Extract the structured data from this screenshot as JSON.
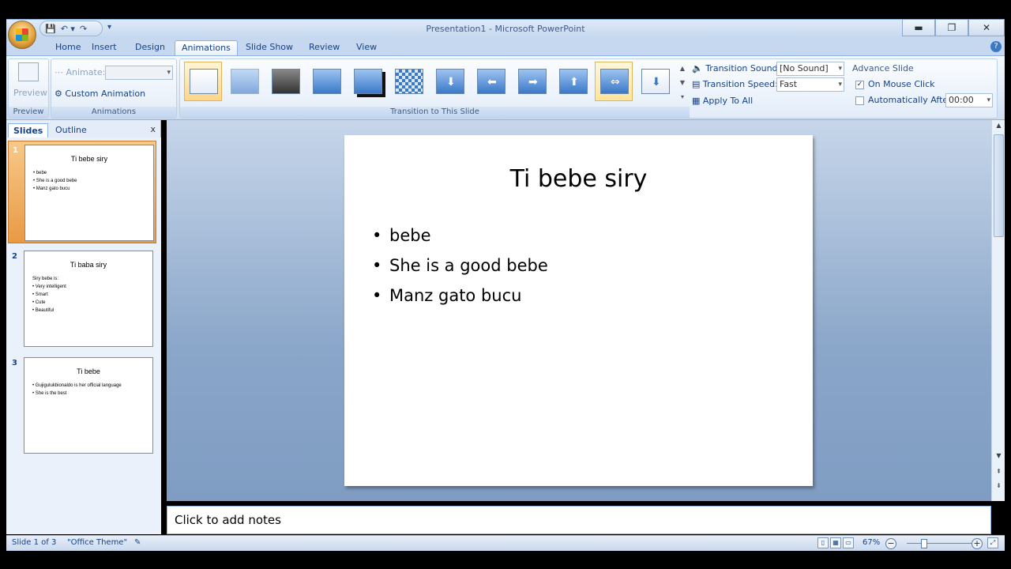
{
  "window": {
    "title": "Presentation1 - Microsoft PowerPoint",
    "minimize": "▬",
    "restore": "❐",
    "close": "✕"
  },
  "qat": {
    "save": "💾",
    "undo": "↶ ▾",
    "redo": "↷",
    "more": "▾"
  },
  "tabs": [
    {
      "label": "Home"
    },
    {
      "label": "Insert"
    },
    {
      "label": "Design"
    },
    {
      "label": "Animations"
    },
    {
      "label": "Slide Show"
    },
    {
      "label": "Review"
    },
    {
      "label": "View"
    }
  ],
  "active_tab": "Animations",
  "ribbon": {
    "preview": {
      "button": "Preview",
      "group": "Preview"
    },
    "animations": {
      "animate_label": "Animate:",
      "custom_animation": "Custom Animation",
      "group": "Animations"
    },
    "transition_group": "Transition to This Slide",
    "transition_sound_label": "Transition Sound:",
    "transition_sound_value": "[No Sound]",
    "transition_speed_label": "Transition Speed:",
    "transition_speed_value": "Fast",
    "apply_to_all": "Apply To All",
    "advance_slide": "Advance Slide",
    "on_mouse_click": "On Mouse Click",
    "on_mouse_click_checked": "✓",
    "automatically_after": "Automatically After:",
    "automatically_after_value": "00:00"
  },
  "slides_panel": {
    "tab_slides": "Slides",
    "tab_outline": "Outline",
    "close": "x",
    "slides": [
      {
        "num": "1",
        "title": "Ti bebe siry",
        "bullets": [
          "bebe",
          "She is a good bebe",
          "Manz gato bucu"
        ]
      },
      {
        "num": "2",
        "title": "Ti baba siry",
        "intro": "Siry bebe is:",
        "bullets": [
          "Very intelligent",
          "Smart",
          "Cute",
          "Beautiful"
        ]
      },
      {
        "num": "3",
        "title": "Ti bebe",
        "bullets": [
          "Gujigulukbionaldo is her official language",
          "She is the best"
        ]
      }
    ]
  },
  "current_slide": {
    "title": "Ti bebe siry",
    "bullets": [
      "bebe",
      "She is a good bebe",
      "Manz gato bucu"
    ]
  },
  "notes_placeholder": "Click to add notes",
  "status": {
    "slide_info": "Slide 1 of 3",
    "theme": "\"Office Theme\"",
    "zoom": "67%"
  }
}
